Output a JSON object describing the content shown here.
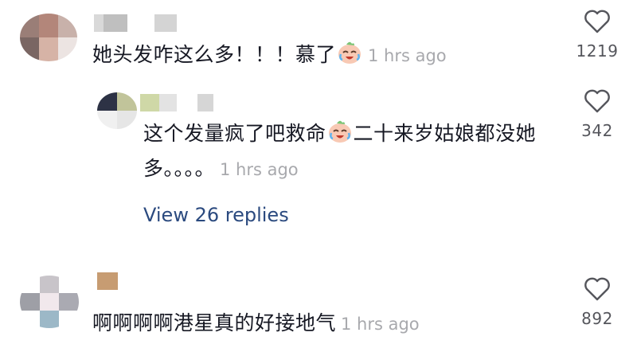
{
  "comments": [
    {
      "text": "她头发咋这么多！！！慕了",
      "time": "1 hrs ago",
      "likes": "1219",
      "emoji": "crying-laughing-emoji",
      "colors": {
        "heart": "#55565c"
      }
    },
    {
      "text_line1": "这个发量疯了吧救命",
      "text_line1b": "二十来岁姑娘都没她",
      "text_line2": "多。。。。",
      "time": "1 hrs ago",
      "likes": "342",
      "emoji": "crying-laughing-emoji",
      "view_replies": "View 26 replies"
    },
    {
      "text": "啊啊啊啊港星真的好接地气",
      "time": "1 hrs ago",
      "likes": "892"
    }
  ],
  "colors": {
    "text": "#161823",
    "time": "#a8a9ad",
    "link": "#2b4a7f",
    "count": "#55565c"
  }
}
